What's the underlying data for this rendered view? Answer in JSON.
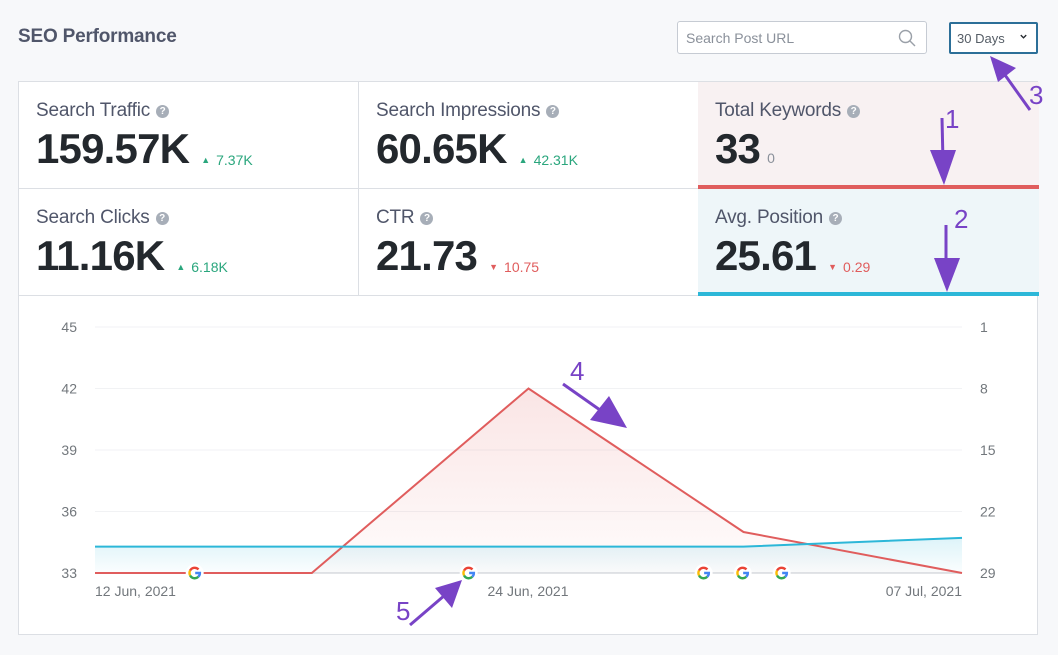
{
  "header": {
    "title": "SEO Performance",
    "search_placeholder": "Search Post URL",
    "search_value": "",
    "range_selected": "30 Days"
  },
  "stats": [
    {
      "label": "Search Traffic",
      "value": "159.57K",
      "delta": "7.37K",
      "trend": "up"
    },
    {
      "label": "Search Impressions",
      "value": "60.65K",
      "delta": "42.31K",
      "trend": "up"
    },
    {
      "label": "Total Keywords",
      "value": "33",
      "delta": "0",
      "trend": "neutral"
    },
    {
      "label": "Search Clicks",
      "value": "11.16K",
      "delta": "6.18K",
      "trend": "up"
    },
    {
      "label": "CTR",
      "value": "21.73",
      "delta": "10.75",
      "trend": "down"
    },
    {
      "label": "Avg. Position",
      "value": "25.61",
      "delta": "0.29",
      "trend": "down"
    }
  ],
  "help_glyph": "?",
  "trend_glyphs": {
    "up": "▲",
    "down": "▼"
  },
  "colors": {
    "keywords": "#e05d5d",
    "position": "#2cb7d8",
    "up": "#2aa67d",
    "down": "#e05d5d",
    "annotation": "#7843c6"
  },
  "annotations": [
    "1",
    "2",
    "3",
    "4",
    "5"
  ],
  "chart_data": {
    "type": "line",
    "title": "",
    "x_tick_labels": [
      "12 Jun, 2021",
      "24 Jun, 2021",
      "07 Jul, 2021"
    ],
    "x_tick_positions": [
      0,
      0.5,
      1
    ],
    "y_left": {
      "label": "Total Keywords",
      "ticks": [
        33,
        36,
        39,
        42,
        45
      ],
      "range": [
        33,
        45
      ]
    },
    "y_right": {
      "label": "Avg. Position",
      "ticks": [
        1,
        8,
        15,
        22,
        29
      ],
      "range": [
        1,
        29
      ],
      "inverted": true
    },
    "grid": true,
    "series": [
      {
        "name": "Total Keywords",
        "axis": "left",
        "color": "#e05d5d",
        "points": [
          {
            "x": 0,
            "y": 33
          },
          {
            "x": 0.25,
            "y": 33
          },
          {
            "x": 0.5,
            "y": 42
          },
          {
            "x": 0.748,
            "y": 35
          },
          {
            "x": 1,
            "y": 33
          }
        ]
      },
      {
        "name": "Avg. Position",
        "axis": "right",
        "color": "#2cb7d8",
        "points": [
          {
            "x": 0,
            "y": 26
          },
          {
            "x": 0.748,
            "y": 26
          },
          {
            "x": 1,
            "y": 25
          }
        ]
      }
    ],
    "google_update_markers": [
      0.115,
      0.431,
      0.702,
      0.747,
      0.792
    ]
  }
}
